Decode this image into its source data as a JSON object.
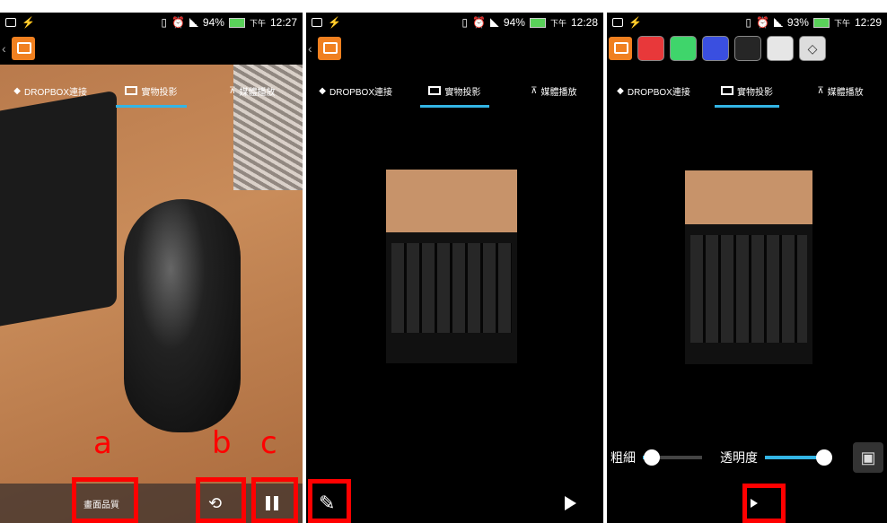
{
  "annotation_letters": {
    "a": "a",
    "b": "b",
    "c": "c"
  },
  "status": {
    "p1": {
      "battery": "94%",
      "time": "12:27",
      "ampm": "下午"
    },
    "p2": {
      "battery": "94%",
      "time": "12:28",
      "ampm": "下午"
    },
    "p3": {
      "battery": "93%",
      "time": "12:29",
      "ampm": "下午"
    }
  },
  "tabs": {
    "dropbox": "DROPBOX連接",
    "projection": "實物投影",
    "media": "媒體播放"
  },
  "p1_bottom": {
    "quality_label": "畫面品質"
  },
  "p3_controls": {
    "thickness_label": "粗細",
    "opacity_label": "透明度",
    "thickness_value": 0.15,
    "opacity_value": 1.0
  },
  "palette": [
    {
      "name": "red",
      "color": "#e8383a"
    },
    {
      "name": "green",
      "color": "#3fd56b"
    },
    {
      "name": "blue",
      "color": "#3a4fe0"
    },
    {
      "name": "black",
      "color": "#262626"
    },
    {
      "name": "white",
      "color": "#e6e6e6"
    }
  ],
  "colors": {
    "accent": "#33b5e5",
    "highlight": "#ff0000",
    "brand": "#f08020"
  }
}
